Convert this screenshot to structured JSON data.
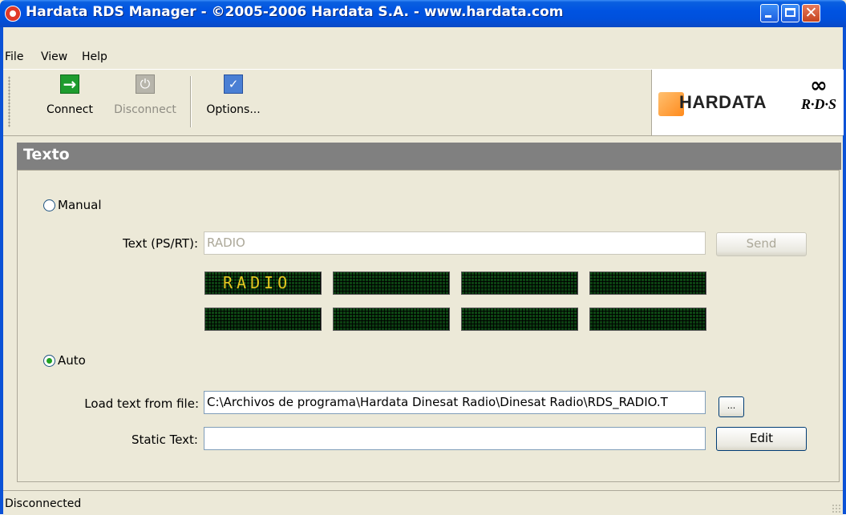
{
  "window": {
    "title": "Hardata RDS Manager - ©2005-2006 Hardata S.A. - www.hardata.com",
    "close_glyph": "✕"
  },
  "menu": [
    "File",
    "View",
    "Help"
  ],
  "toolbar": {
    "connect_label": "Connect",
    "disconnect_label": "Disconnect",
    "options_label": "Options...",
    "connect_icon": "→",
    "disconnect_icon": "⏻",
    "options_icon": "✓"
  },
  "logos": {
    "hardata": "HARDATA",
    "rds": "R·D·S",
    "rds_rings": "∞"
  },
  "panel": {
    "title": "Texto"
  },
  "manual": {
    "radio_label": "Manual",
    "selected": false,
    "text_label": "Text (PS/RT):",
    "text_value": "RADIO",
    "send_label": "Send",
    "led_row1": [
      "RADIO",
      "",
      "",
      ""
    ],
    "led_row2": [
      "",
      "",
      "",
      ""
    ]
  },
  "auto": {
    "radio_label": "Auto",
    "selected": true,
    "load_label": "Load text from file:",
    "file_path": "C:\\Archivos de programa\\Hardata Dinesat Radio\\Dinesat Radio\\RDS_RADIO.T",
    "browse_label": "...",
    "static_label": "Static Text:",
    "static_value": "",
    "edit_label": "Edit"
  },
  "status": {
    "text": "Disconnected"
  },
  "colors": {
    "titlebar": "#0053e1",
    "led_text": "#e3c520",
    "panel_header": "#808080"
  }
}
